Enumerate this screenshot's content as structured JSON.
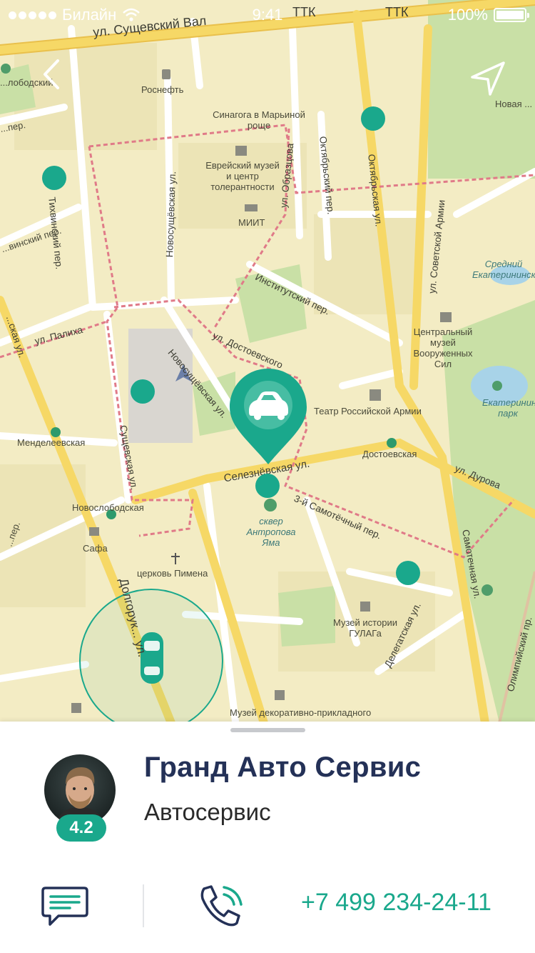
{
  "status_bar": {
    "carrier": "Билайн",
    "time": "9:41",
    "battery": "100%"
  },
  "map": {
    "streets": {
      "sushchevsky_val": "ул. Сущевский Вал",
      "ttk_top": "ТТК",
      "ttk_top2": "ТТК",
      "novosushch": "Новосущёвская ул.",
      "novosushch2": "Новосущёвская ул.",
      "tikhvinsky": "Тихвинский пер.",
      "institutsky": "Институтский пер.",
      "dostoevskogo": "ул. Достоевского",
      "palikha": "ул. Палиха",
      "seleznevskaya": "Селезнёвская ул.",
      "samotechny": "3-й Самотёчный пер.",
      "oktyabrskaya": "Октябрьская ул.",
      "oktyabrsky": "Октябрьский пер.",
      "sov_armii": "ул. Советской Армии",
      "durova": "ул. Дурова",
      "samotechnaya": "Самотечная ул.",
      "suschevskaya": "Сущевская ул.",
      "delegatskaya": "Делегатская ул.",
      "dolgoruk": "Долгорук... ул.",
      "olimp": "Олимпийский пр.",
      "obraztsova": "ул. Образцова",
      "vinsky": "...винский пер.",
      "per_left": "...пер.",
      "novaya": "Новая ...",
      "lobodsky": "...лободский",
      "kaya": "...ская ул."
    },
    "pois": {
      "rosneft": "Роснефть",
      "synagogue": "Синагога в Марьиной роще",
      "museum_jew": "Еврейский музей и центр толерантности",
      "miit": "МИИТ",
      "mendeleevskaya": "Менделеевская",
      "novoslobodskaya": "Новослободская",
      "safa": "Сафа",
      "church": "церковь Пимена",
      "theatre": "Театр Российской Армии",
      "dostoevskaya": "Достоевская",
      "museum_army": "Центральный музей Вооруженных Сил",
      "park_small": "Средний Екатерининский",
      "park_ekat": "Екатерининский парк",
      "skver": "сквер Антропова Яма",
      "gulag": "Музей истории ГУЛАГа",
      "museum_dec": "Музей декоративно-прикладного"
    }
  },
  "place": {
    "name": "Гранд Авто Сервис",
    "category": "Автосервис",
    "rating": "4.2",
    "phone": "+7 499 234-24-11"
  },
  "icons": {
    "back": "chevron-left-icon",
    "locate": "navigation-arrow-icon",
    "pin": "car-pin-icon",
    "chat": "chat-bubble-icon",
    "call": "phone-icon"
  },
  "colors": {
    "accent": "#1aa88c",
    "title": "#243157",
    "map_bg": "#f3ecc4",
    "road": "#ffffff",
    "major_road": "#f6d866"
  }
}
